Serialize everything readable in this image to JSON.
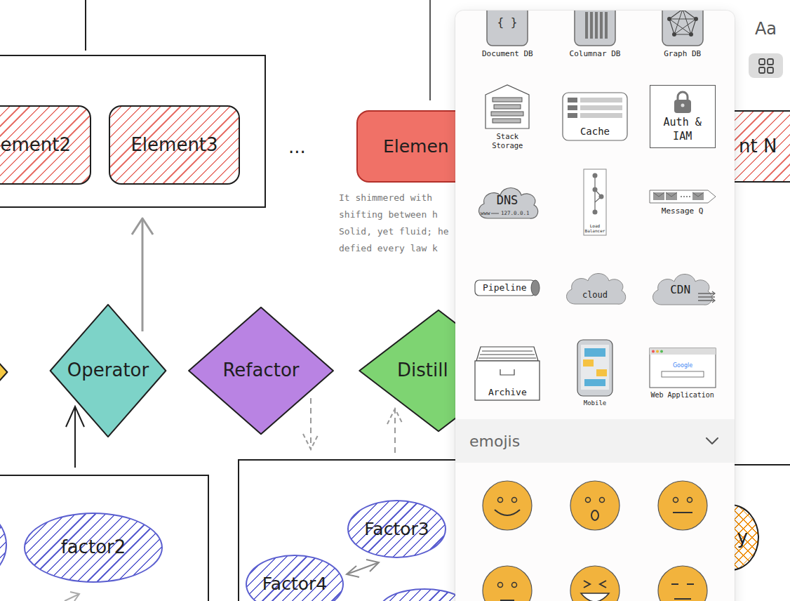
{
  "toolbar": {
    "font_button": "Aa",
    "library_button": {
      "selected": true
    }
  },
  "canvas": {
    "boxes": [
      {
        "label": "ement2",
        "fill": "hatch",
        "color": "#e8736b"
      },
      {
        "label": "Element3",
        "fill": "hatch",
        "color": "#e8736b"
      },
      {
        "label": "Elemen",
        "fill": "solid",
        "color": "#f07167"
      },
      {
        "label": "nt N",
        "fill": "hatch",
        "color": "#e8736b"
      }
    ],
    "ellipsis": "...",
    "note": [
      "It shimmered with",
      "shifting between h",
      "Solid, yet fluid; he",
      "defied every law k"
    ],
    "diamonds": [
      {
        "color": "#f5c842"
      },
      {
        "label": "Operator",
        "color": "#7dd3c8"
      },
      {
        "label": "Refactor",
        "color": "#b983e3"
      },
      {
        "label": "Distill",
        "color": "#7ed472"
      }
    ],
    "ellipses": [
      {
        "fill": "hatch",
        "color": "#5b5fd0"
      },
      {
        "label": "factor2",
        "fill": "hatch",
        "color": "#5b5fd0"
      },
      {
        "label": "Factor3",
        "fill": "hatch",
        "color": "#5b5fd0"
      },
      {
        "label": "Factor4",
        "fill": "hatch",
        "color": "#5b5fd0"
      },
      {
        "fill": "hatch",
        "color": "#5b5fd0"
      },
      {
        "label": "y",
        "fill": "crosshatch",
        "color": "#f08c00"
      }
    ]
  },
  "library": {
    "items": [
      {
        "kind": "document",
        "label": "Document DB",
        "glyphs": [
          "{ }"
        ]
      },
      {
        "kind": "columnar",
        "label": "Columnar DB"
      },
      {
        "kind": "graph",
        "label": "Graph DB"
      },
      {
        "kind": "stack",
        "label": "Stack Storage"
      },
      {
        "kind": "cache",
        "label": "Cache"
      },
      {
        "kind": "auth",
        "label": "Auth & IAM"
      },
      {
        "kind": "dns",
        "label": "DNS",
        "glyphs": [
          "www",
          "127.0.0.1"
        ]
      },
      {
        "kind": "balancer",
        "label": "Load Balancer"
      },
      {
        "kind": "queue",
        "label": "Message Q"
      },
      {
        "kind": "pipeline",
        "label": "Pipeline"
      },
      {
        "kind": "cloud",
        "label": "cloud"
      },
      {
        "kind": "cdn",
        "label": "CDN"
      },
      {
        "kind": "archive",
        "label": "Archive"
      },
      {
        "kind": "mobile",
        "label": "Mobile"
      },
      {
        "kind": "webapp",
        "label": "Web Application",
        "glyphs": [
          "Google"
        ]
      }
    ]
  },
  "emojis": {
    "title": "emojis",
    "expanded": true,
    "faces": [
      {
        "kind": "smile"
      },
      {
        "kind": "surprised"
      },
      {
        "kind": "neutral"
      },
      {
        "kind": "plain"
      },
      {
        "kind": "squint"
      },
      {
        "kind": "meh"
      }
    ]
  }
}
